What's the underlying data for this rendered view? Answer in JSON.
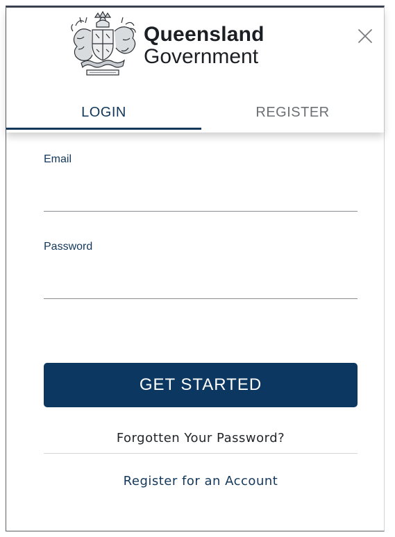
{
  "header": {
    "brand_line1": "Queensland",
    "brand_line2": "Government",
    "close_label": "×"
  },
  "tabs": [
    {
      "label": "LOGIN",
      "active": true
    },
    {
      "label": "REGISTER",
      "active": false
    }
  ],
  "form": {
    "email": {
      "label": "Email",
      "value": "",
      "placeholder": ""
    },
    "password": {
      "label": "Password",
      "value": "",
      "placeholder": ""
    },
    "submit_label": "GET STARTED"
  },
  "links": {
    "forgot": "Forgotten Your Password?",
    "register": "Register for an Account"
  },
  "colors": {
    "primary": "#0b3761",
    "active_tab": "#12375a",
    "inactive_tab": "#6c6f73"
  },
  "icons": {
    "crest": "queensland-coat-of-arms-icon",
    "close": "close-icon"
  }
}
